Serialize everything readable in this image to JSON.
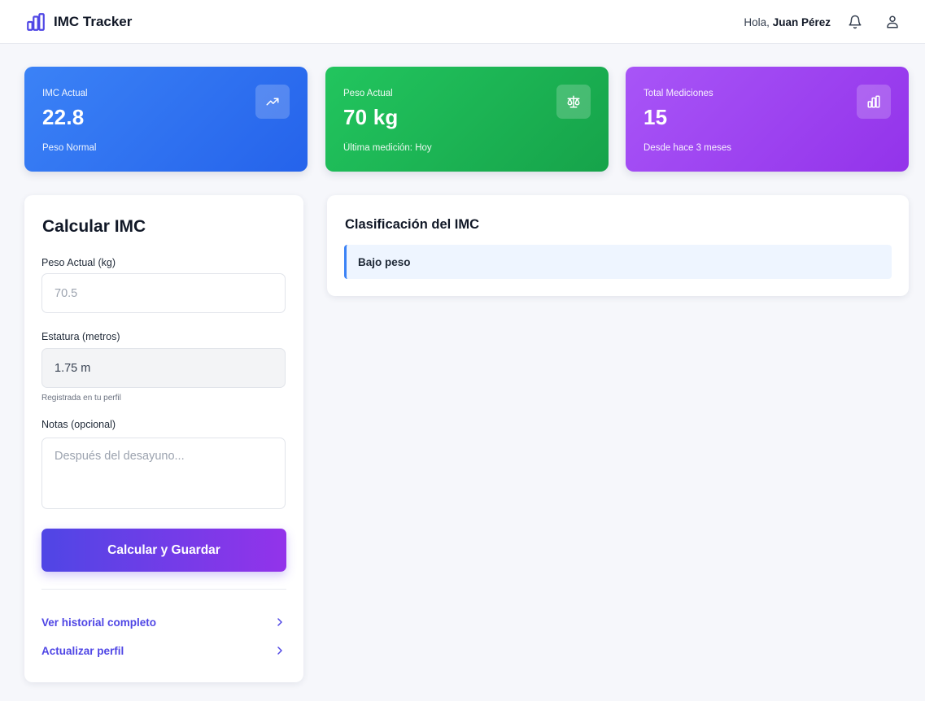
{
  "header": {
    "app_name": "IMC Tracker",
    "greeting_prefix": "Hola,",
    "user_name": "Juan Pérez"
  },
  "stats": [
    {
      "label": "IMC Actual",
      "value": "22.8",
      "sub": "Peso Normal",
      "icon": "trending-up-icon",
      "color": "#3b82f6"
    },
    {
      "label": "Peso Actual",
      "value": "70 kg",
      "sub": "Última medición: Hoy",
      "icon": "scale-icon",
      "color": "#22c55e"
    },
    {
      "label": "Total Mediciones",
      "value": "15",
      "sub": "Desde hace 3 meses",
      "icon": "bar-chart-icon",
      "color": "#a855f7"
    }
  ],
  "calculator": {
    "title": "Calcular IMC",
    "weight_label": "Peso Actual (kg)",
    "weight_placeholder": "70.5",
    "height_label": "Estatura (metros)",
    "height_value": "1.75 m",
    "height_hint": "Registrada en tu perfil",
    "notes_label": "Notas (opcional)",
    "notes_placeholder": "Después del desayuno...",
    "submit_label": "Calcular y Guardar",
    "links": [
      {
        "label": "Ver historial completo"
      },
      {
        "label": "Actualizar perfil"
      }
    ]
  },
  "classification": {
    "title": "Clasificación del IMC",
    "items": [
      "Bajo peso"
    ],
    "accent": "#3b82f6"
  }
}
